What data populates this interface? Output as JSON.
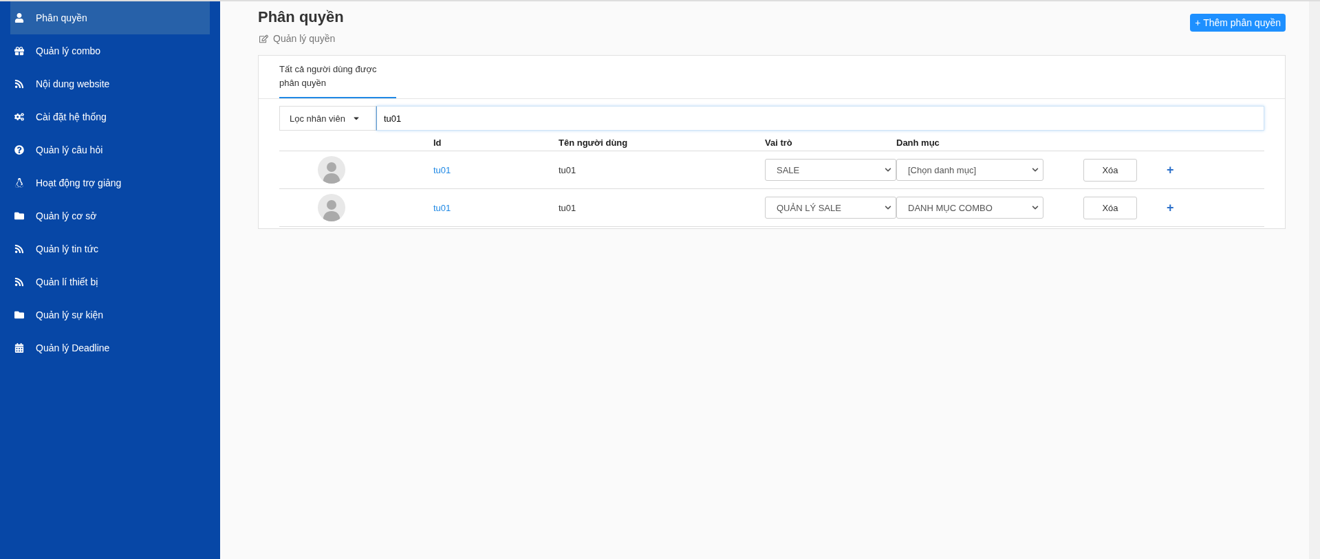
{
  "sidebar": {
    "items": [
      {
        "label": "Phân quyền",
        "selected": true
      },
      {
        "label": "Quản lý combo",
        "selected": false
      },
      {
        "label": "Nội dung website",
        "selected": false
      },
      {
        "label": "Cài đặt hệ thống",
        "selected": false
      },
      {
        "label": "Quản lý câu hỏi",
        "selected": false
      },
      {
        "label": "Hoạt động trợ giảng",
        "selected": false
      },
      {
        "label": "Quản lý cơ sở",
        "selected": false
      },
      {
        "label": "Quản lý tin tức",
        "selected": false
      },
      {
        "label": "Quản lí thiết bị",
        "selected": false
      },
      {
        "label": "Quản lý sự kiện",
        "selected": false
      },
      {
        "label": "Quản lý Deadline",
        "selected": false
      }
    ]
  },
  "header": {
    "title": "Phân quyền",
    "subtitle": "Quản lý quyền",
    "add_button": "+ Thêm phân quyền"
  },
  "tabs": [
    {
      "label": "Tất cả người dùng được phân quyền",
      "selected": true
    }
  ],
  "filter": {
    "dropdown": "Lọc nhân viên",
    "value": "tu01"
  },
  "table": {
    "columns": [
      "Id",
      "Tên người dùng",
      "Vai trò",
      "Danh mục"
    ],
    "rows": [
      {
        "id": "tu01",
        "name": "tu01",
        "role": "SALE",
        "category": "[Chọn danh mục]",
        "delete": "Xóa",
        "add": "+"
      },
      {
        "id": "tu01",
        "name": "tu01",
        "role": "QUẢN LÝ SALE",
        "category": "DANH MỤC COMBO",
        "delete": "Xóa",
        "add": "+"
      }
    ]
  }
}
